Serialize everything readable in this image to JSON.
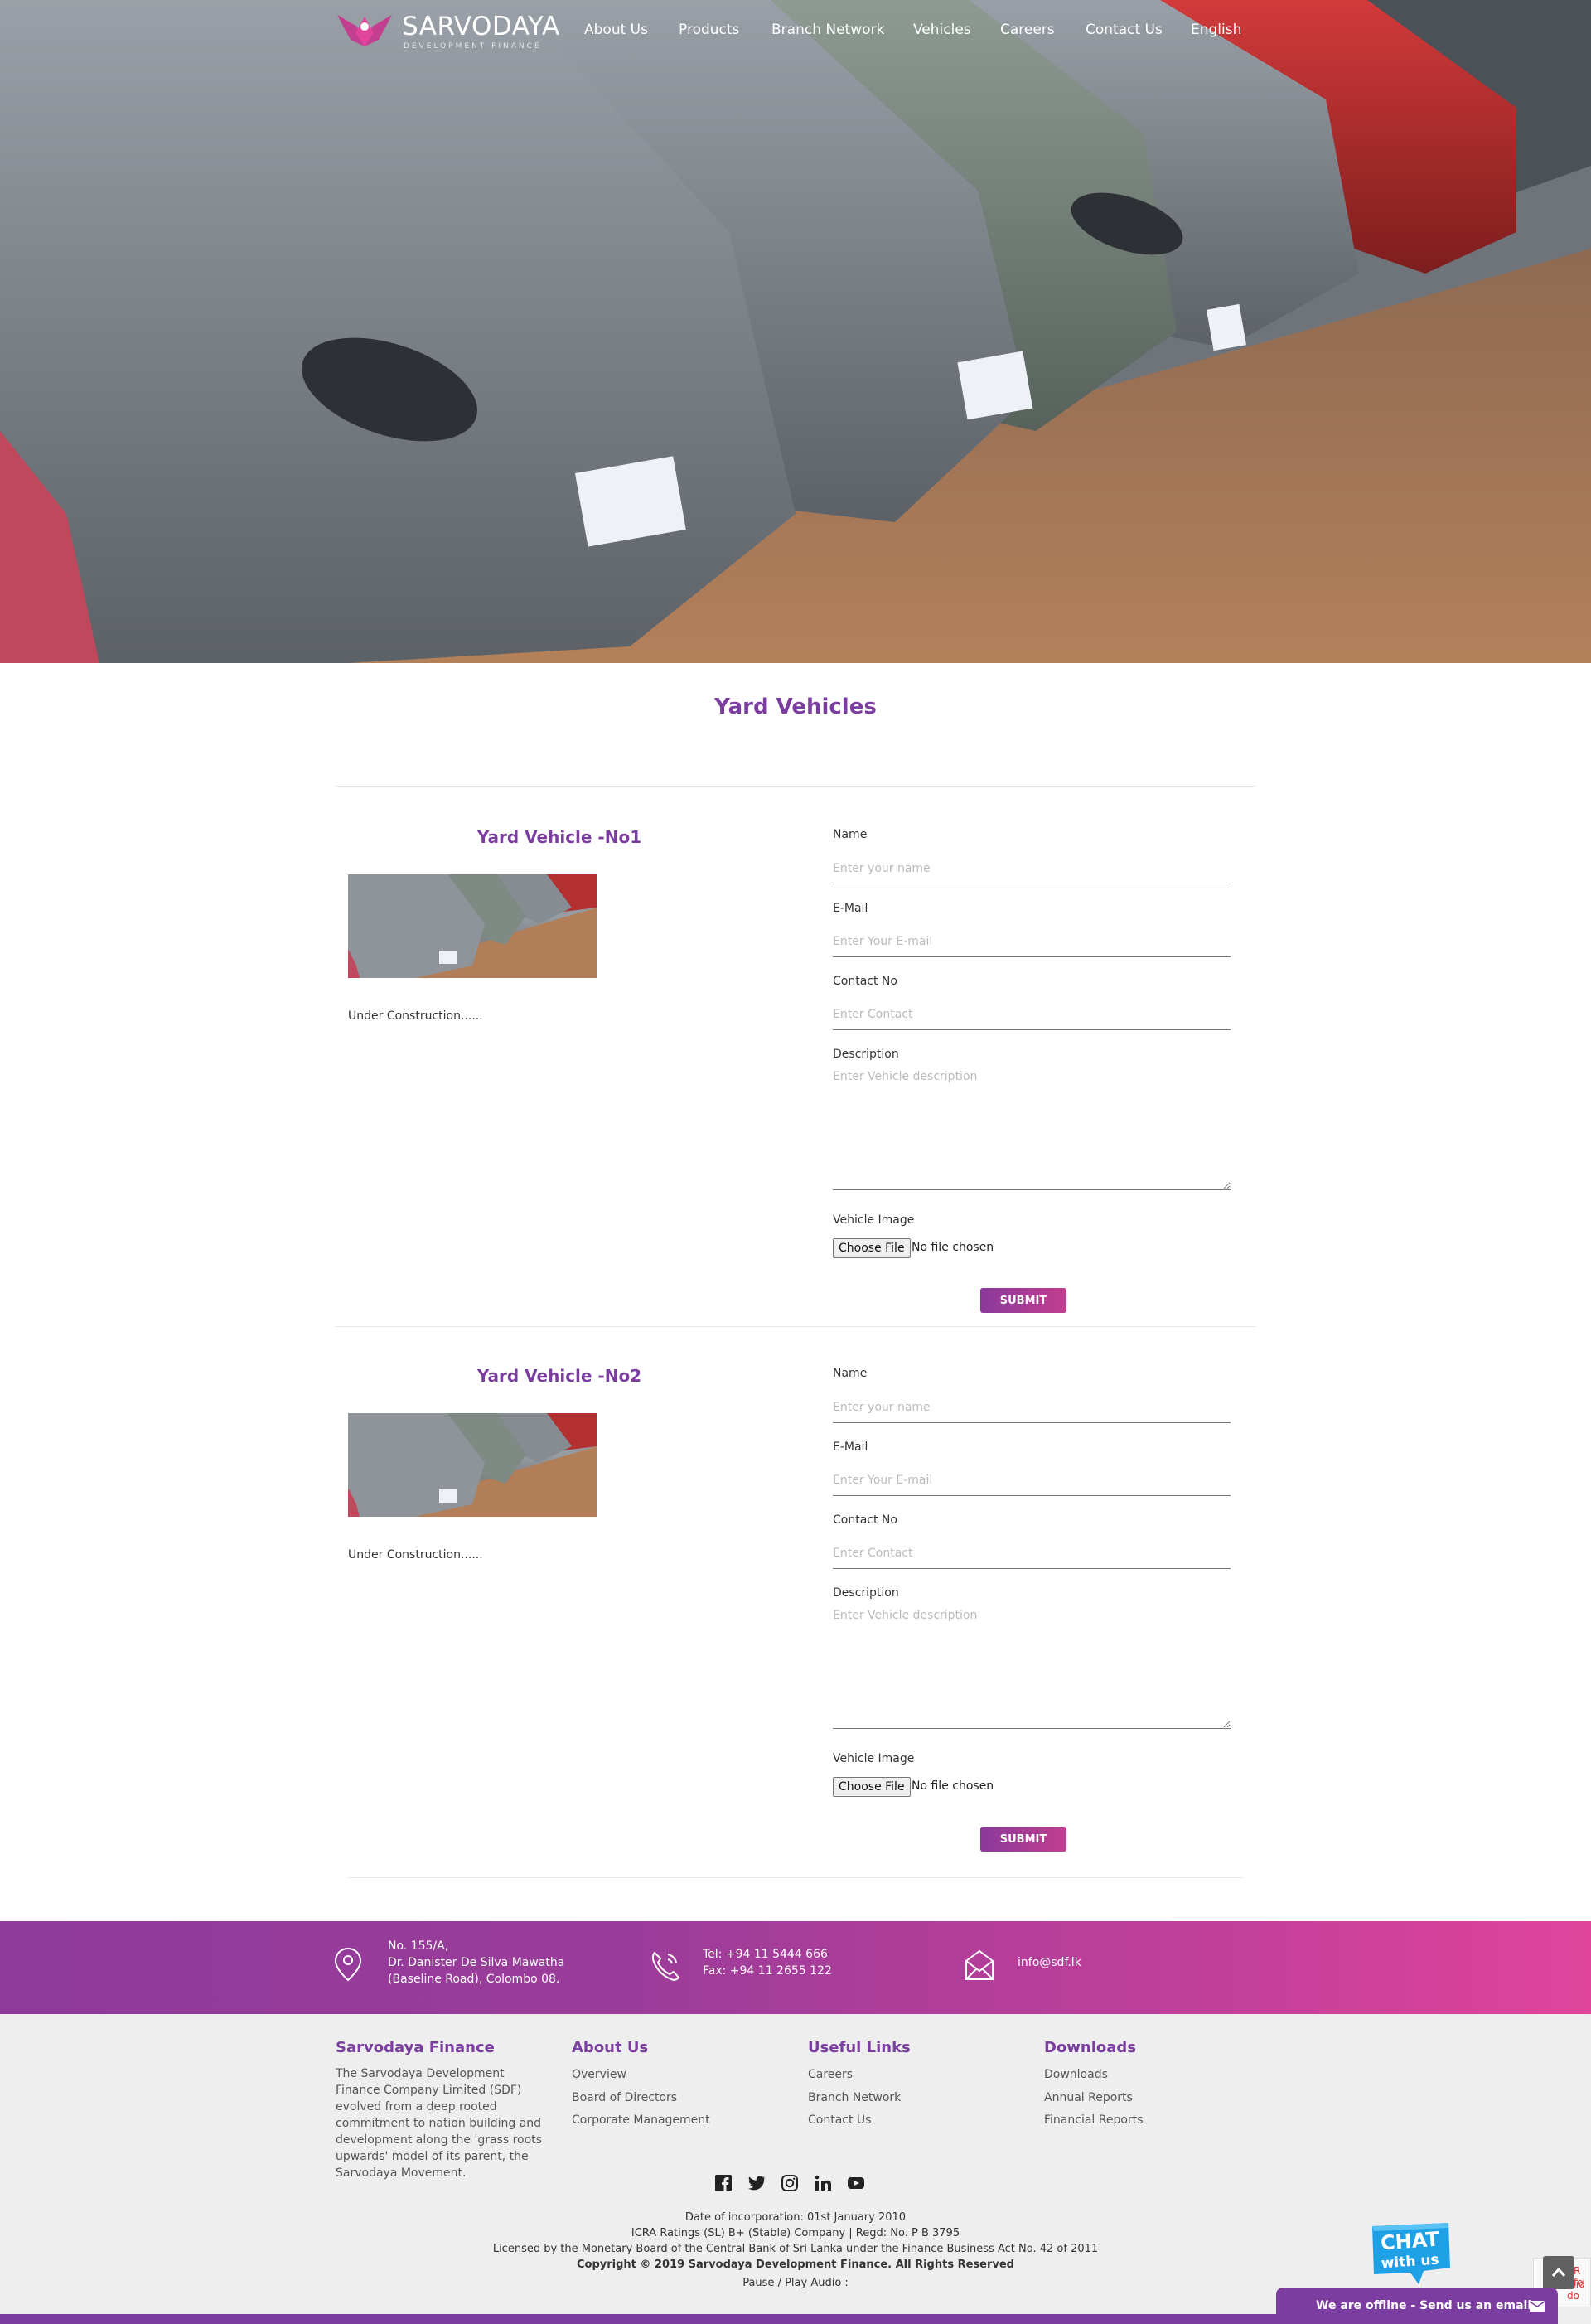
{
  "brand": {
    "name": "SARVODAYA",
    "sub": "DEVELOPMENT FINANCE"
  },
  "nav": [
    "About Us",
    "Products",
    "Branch Network",
    "Vehicles",
    "Careers",
    "Contact Us",
    "English"
  ],
  "page_title": "Yard Vehicles",
  "vehicles": [
    {
      "title": "Yard Vehicle -No1",
      "status": "Under Construction......",
      "form": {
        "name_label": "Name",
        "name_placeholder": "Enter your name",
        "email_label": "E-Mail",
        "email_placeholder": "Enter Your E-mail",
        "contact_label": "Contact No",
        "contact_placeholder": "Enter Contact",
        "desc_label": "Description",
        "desc_placeholder": "Enter Vehicle description",
        "image_label": "Vehicle Image",
        "file_button": "Choose File",
        "file_status": "No file chosen",
        "submit": "SUBMIT"
      }
    },
    {
      "title": "Yard Vehicle -No2",
      "status": "Under Construction......",
      "form": {
        "name_label": "Name",
        "name_placeholder": "Enter your name",
        "email_label": "E-Mail",
        "email_placeholder": "Enter Your E-mail",
        "contact_label": "Contact No",
        "contact_placeholder": "Enter Contact",
        "desc_label": "Description",
        "desc_placeholder": "Enter Vehicle description",
        "image_label": "Vehicle Image",
        "file_button": "Choose File",
        "file_status": "No file chosen",
        "submit": "SUBMIT"
      }
    }
  ],
  "contact": {
    "address": [
      "No. 155/A,",
      "Dr. Danister De Silva Mawatha",
      "(Baseline Road), Colombo 08."
    ],
    "phone": [
      "Tel: +94 11 5444 666",
      "Fax: +94 11 2655 122"
    ],
    "email": "info@sdf.lk"
  },
  "footer": {
    "about": {
      "heading": "Sarvodaya Finance",
      "text": "The Sarvodaya Development Finance Company Limited (SDF) evolved from a deep rooted commitment to nation building and development along the 'grass roots upwards' model of its parent, the Sarvodaya Movement."
    },
    "about_us": {
      "heading": "About Us",
      "links": [
        "Overview",
        "Board of Directors",
        "Corporate Management"
      ]
    },
    "useful": {
      "heading": "Useful Links",
      "links": [
        "Careers",
        "Branch Network",
        "Contact Us"
      ]
    },
    "downloads": {
      "heading": "Downloads",
      "links": [
        "Downloads",
        "Annual Reports",
        "Financial Reports"
      ]
    },
    "social_icons": [
      "facebook-icon",
      "twitter-icon",
      "instagram-icon",
      "linkedin-icon",
      "youtube-icon"
    ],
    "legal": [
      "Date of incorporation: 01st January 2010",
      "ICRA Ratings (SL) B+ (Stable) Company | Regd: No. P B 3795",
      "Licensed by the Monetary Board of the Central Bank of Sri Lanka under the Finance Business Act No. 42 of 2011"
    ],
    "copyright": "Copyright © 2019 Sarvodaya Development Finance. All Rights Reserved",
    "audio": "Pause / Play Audio :"
  },
  "chat": {
    "badge_line1": "CHAT",
    "badge_line2": "with us",
    "offline": "We are offline - Send us an email"
  },
  "recaptcha": {
    "line1": "R fo",
    "line2": "alid do"
  },
  "colors": {
    "primary": "#7b3ea0",
    "accent": "#e0449b"
  }
}
